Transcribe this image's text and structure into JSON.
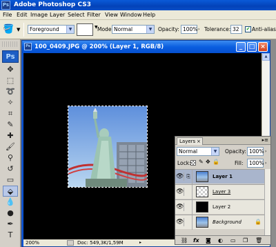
{
  "app": {
    "title": "Adobe Photoshop CS3",
    "logo": "Ps"
  },
  "menu": [
    "File",
    "Edit",
    "Image",
    "Layer",
    "Select",
    "Filter",
    "View",
    "Window",
    "Help"
  ],
  "options": {
    "tool_icon": "paint-bucket-icon",
    "fill_source": "Foreground",
    "mode_label": "Mode:",
    "mode_value": "Normal",
    "opacity_label": "Opacity:",
    "opacity_value": "100%",
    "tolerance_label": "Tolerance:",
    "tolerance_value": "32",
    "antialias_label": "Anti-alias",
    "antialias_checked": true
  },
  "toolbox": {
    "badge": "Ps"
  },
  "document": {
    "title": "100_0409.JPG @ 200% (Layer 1, RGB/8)",
    "zoom": "200%",
    "doc_size": "Doc: 549,3K/1,59M"
  },
  "layers_panel": {
    "tab": "Layers",
    "close": "×",
    "blend_mode": "Normal",
    "opacity_label": "Opacity:",
    "opacity_value": "100%",
    "lock_label": "Lock:",
    "fill_label": "Fill:",
    "fill_value": "100%",
    "layers": [
      {
        "name": "Layer 1",
        "selected": true,
        "thumb": "picture",
        "style": "bold"
      },
      {
        "name": "Layer 3",
        "selected": false,
        "thumb": "transparent",
        "style": "underline"
      },
      {
        "name": "Layer 2",
        "selected": false,
        "thumb": "black",
        "style": "normal"
      },
      {
        "name": "Background",
        "selected": false,
        "thumb": "picture",
        "style": "italic",
        "locked": true
      }
    ]
  },
  "colors": {
    "titlebar": "#0342b8",
    "canvas": "#000000",
    "panel": "#d4d0c8",
    "selected_layer": "#a9b5cc"
  }
}
